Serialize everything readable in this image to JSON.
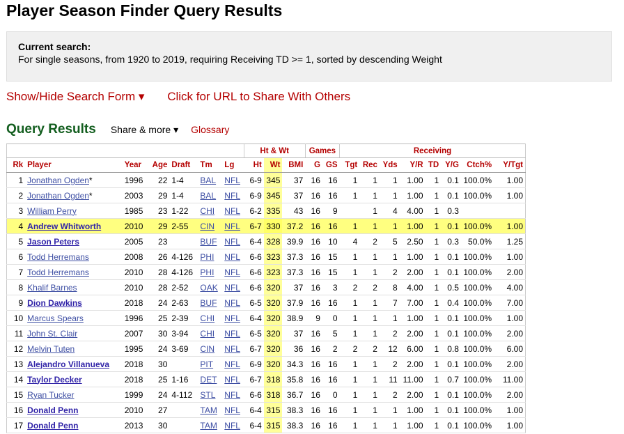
{
  "page_title": "Player Season Finder Query Results",
  "search": {
    "label": "Current search:",
    "text": "For single seasons, from 1920 to 2019, requiring Receiving TD >= 1, sorted by descending Weight"
  },
  "links": {
    "toggle_form": "Show/Hide Search Form ▾",
    "share_url": "Click for URL to Share With Others"
  },
  "results": {
    "title": "Query Results",
    "share_more": "Share & more ▾",
    "glossary": "Glossary"
  },
  "table": {
    "over_headers": {
      "htwt": "Ht & Wt",
      "games": "Games",
      "receiving": "Receiving"
    },
    "columns": [
      "Rk",
      "Player",
      "Year",
      "Age",
      "Draft",
      "Tm",
      "Lg",
      "Ht",
      "Wt",
      "BMI",
      "G",
      "GS",
      "Tgt",
      "Rec",
      "Yds",
      "Y/R",
      "TD",
      "Y/G",
      "Ctch%",
      "Y/Tgt"
    ],
    "rows": [
      {
        "rk": "1",
        "player": "Jonathan Ogden",
        "star": "*",
        "bold": false,
        "year": "1996",
        "age": "22",
        "draft": "1-4",
        "tm": "BAL",
        "lg": "NFL",
        "ht": "6-9",
        "wt": "345",
        "bmi": "37",
        "g": "16",
        "gs": "16",
        "tgt": "1",
        "rec": "1",
        "yds": "1",
        "yr": "1.00",
        "td": "1",
        "yg": "0.1",
        "ctch": "100.0%",
        "ytgt": "1.00"
      },
      {
        "rk": "2",
        "player": "Jonathan Ogden",
        "star": "*",
        "bold": false,
        "year": "2003",
        "age": "29",
        "draft": "1-4",
        "tm": "BAL",
        "lg": "NFL",
        "ht": "6-9",
        "wt": "345",
        "bmi": "37",
        "g": "16",
        "gs": "16",
        "tgt": "1",
        "rec": "1",
        "yds": "1",
        "yr": "1.00",
        "td": "1",
        "yg": "0.1",
        "ctch": "100.0%",
        "ytgt": "1.00"
      },
      {
        "rk": "3",
        "player": "William Perry",
        "star": "",
        "bold": false,
        "year": "1985",
        "age": "23",
        "draft": "1-22",
        "tm": "CHI",
        "lg": "NFL",
        "ht": "6-2",
        "wt": "335",
        "bmi": "43",
        "g": "16",
        "gs": "9",
        "tgt": "",
        "rec": "1",
        "yds": "4",
        "yr": "4.00",
        "td": "1",
        "yg": "0.3",
        "ctch": "",
        "ytgt": ""
      },
      {
        "rk": "4",
        "player": "Andrew Whitworth",
        "star": "",
        "bold": true,
        "hl": true,
        "year": "2010",
        "age": "29",
        "draft": "2-55",
        "tm": "CIN",
        "lg": "NFL",
        "ht": "6-7",
        "wt": "330",
        "bmi": "37.2",
        "g": "16",
        "gs": "16",
        "tgt": "1",
        "rec": "1",
        "yds": "1",
        "yr": "1.00",
        "td": "1",
        "yg": "0.1",
        "ctch": "100.0%",
        "ytgt": "1.00"
      },
      {
        "rk": "5",
        "player": "Jason Peters",
        "star": "",
        "bold": true,
        "year": "2005",
        "age": "23",
        "draft": "",
        "tm": "BUF",
        "lg": "NFL",
        "ht": "6-4",
        "wt": "328",
        "bmi": "39.9",
        "g": "16",
        "gs": "10",
        "tgt": "4",
        "rec": "2",
        "yds": "5",
        "yr": "2.50",
        "td": "1",
        "yg": "0.3",
        "ctch": "50.0%",
        "ytgt": "1.25"
      },
      {
        "rk": "6",
        "player": "Todd Herremans",
        "star": "",
        "bold": false,
        "year": "2008",
        "age": "26",
        "draft": "4-126",
        "tm": "PHI",
        "lg": "NFL",
        "ht": "6-6",
        "wt": "323",
        "bmi": "37.3",
        "g": "16",
        "gs": "15",
        "tgt": "1",
        "rec": "1",
        "yds": "1",
        "yr": "1.00",
        "td": "1",
        "yg": "0.1",
        "ctch": "100.0%",
        "ytgt": "1.00"
      },
      {
        "rk": "7",
        "player": "Todd Herremans",
        "star": "",
        "bold": false,
        "year": "2010",
        "age": "28",
        "draft": "4-126",
        "tm": "PHI",
        "lg": "NFL",
        "ht": "6-6",
        "wt": "323",
        "bmi": "37.3",
        "g": "16",
        "gs": "15",
        "tgt": "1",
        "rec": "1",
        "yds": "2",
        "yr": "2.00",
        "td": "1",
        "yg": "0.1",
        "ctch": "100.0%",
        "ytgt": "2.00"
      },
      {
        "rk": "8",
        "player": "Khalif Barnes",
        "star": "",
        "bold": false,
        "year": "2010",
        "age": "28",
        "draft": "2-52",
        "tm": "OAK",
        "lg": "NFL",
        "ht": "6-6",
        "wt": "320",
        "bmi": "37",
        "g": "16",
        "gs": "3",
        "tgt": "2",
        "rec": "2",
        "yds": "8",
        "yr": "4.00",
        "td": "1",
        "yg": "0.5",
        "ctch": "100.0%",
        "ytgt": "4.00"
      },
      {
        "rk": "9",
        "player": "Dion Dawkins",
        "star": "",
        "bold": true,
        "year": "2018",
        "age": "24",
        "draft": "2-63",
        "tm": "BUF",
        "lg": "NFL",
        "ht": "6-5",
        "wt": "320",
        "bmi": "37.9",
        "g": "16",
        "gs": "16",
        "tgt": "1",
        "rec": "1",
        "yds": "7",
        "yr": "7.00",
        "td": "1",
        "yg": "0.4",
        "ctch": "100.0%",
        "ytgt": "7.00"
      },
      {
        "rk": "10",
        "player": "Marcus Spears",
        "star": "",
        "bold": false,
        "year": "1996",
        "age": "25",
        "draft": "2-39",
        "tm": "CHI",
        "lg": "NFL",
        "ht": "6-4",
        "wt": "320",
        "bmi": "38.9",
        "g": "9",
        "gs": "0",
        "tgt": "1",
        "rec": "1",
        "yds": "1",
        "yr": "1.00",
        "td": "1",
        "yg": "0.1",
        "ctch": "100.0%",
        "ytgt": "1.00"
      },
      {
        "rk": "11",
        "player": "John St. Clair",
        "star": "",
        "bold": false,
        "year": "2007",
        "age": "30",
        "draft": "3-94",
        "tm": "CHI",
        "lg": "NFL",
        "ht": "6-5",
        "wt": "320",
        "bmi": "37",
        "g": "16",
        "gs": "5",
        "tgt": "1",
        "rec": "1",
        "yds": "2",
        "yr": "2.00",
        "td": "1",
        "yg": "0.1",
        "ctch": "100.0%",
        "ytgt": "2.00"
      },
      {
        "rk": "12",
        "player": "Melvin Tuten",
        "star": "",
        "bold": false,
        "year": "1995",
        "age": "24",
        "draft": "3-69",
        "tm": "CIN",
        "lg": "NFL",
        "ht": "6-7",
        "wt": "320",
        "bmi": "36",
        "g": "16",
        "gs": "2",
        "tgt": "2",
        "rec": "2",
        "yds": "12",
        "yr": "6.00",
        "td": "1",
        "yg": "0.8",
        "ctch": "100.0%",
        "ytgt": "6.00"
      },
      {
        "rk": "13",
        "player": "Alejandro Villanueva",
        "star": "",
        "bold": true,
        "year": "2018",
        "age": "30",
        "draft": "",
        "tm": "PIT",
        "lg": "NFL",
        "ht": "6-9",
        "wt": "320",
        "bmi": "34.3",
        "g": "16",
        "gs": "16",
        "tgt": "1",
        "rec": "1",
        "yds": "2",
        "yr": "2.00",
        "td": "1",
        "yg": "0.1",
        "ctch": "100.0%",
        "ytgt": "2.00"
      },
      {
        "rk": "14",
        "player": "Taylor Decker",
        "star": "",
        "bold": true,
        "year": "2018",
        "age": "25",
        "draft": "1-16",
        "tm": "DET",
        "lg": "NFL",
        "ht": "6-7",
        "wt": "318",
        "bmi": "35.8",
        "g": "16",
        "gs": "16",
        "tgt": "1",
        "rec": "1",
        "yds": "11",
        "yr": "11.00",
        "td": "1",
        "yg": "0.7",
        "ctch": "100.0%",
        "ytgt": "11.00"
      },
      {
        "rk": "15",
        "player": "Ryan Tucker",
        "star": "",
        "bold": false,
        "year": "1999",
        "age": "24",
        "draft": "4-112",
        "tm": "STL",
        "lg": "NFL",
        "ht": "6-6",
        "wt": "318",
        "bmi": "36.7",
        "g": "16",
        "gs": "0",
        "tgt": "1",
        "rec": "1",
        "yds": "2",
        "yr": "2.00",
        "td": "1",
        "yg": "0.1",
        "ctch": "100.0%",
        "ytgt": "2.00"
      },
      {
        "rk": "16",
        "player": "Donald Penn",
        "star": "",
        "bold": true,
        "year": "2010",
        "age": "27",
        "draft": "",
        "tm": "TAM",
        "lg": "NFL",
        "ht": "6-4",
        "wt": "315",
        "bmi": "38.3",
        "g": "16",
        "gs": "16",
        "tgt": "1",
        "rec": "1",
        "yds": "1",
        "yr": "1.00",
        "td": "1",
        "yg": "0.1",
        "ctch": "100.0%",
        "ytgt": "1.00"
      },
      {
        "rk": "17",
        "player": "Donald Penn",
        "star": "",
        "bold": true,
        "year": "2013",
        "age": "30",
        "draft": "",
        "tm": "TAM",
        "lg": "NFL",
        "ht": "6-4",
        "wt": "315",
        "bmi": "38.3",
        "g": "16",
        "gs": "16",
        "tgt": "1",
        "rec": "1",
        "yds": "1",
        "yr": "1.00",
        "td": "1",
        "yg": "0.1",
        "ctch": "100.0%",
        "ytgt": "1.00"
      }
    ]
  }
}
